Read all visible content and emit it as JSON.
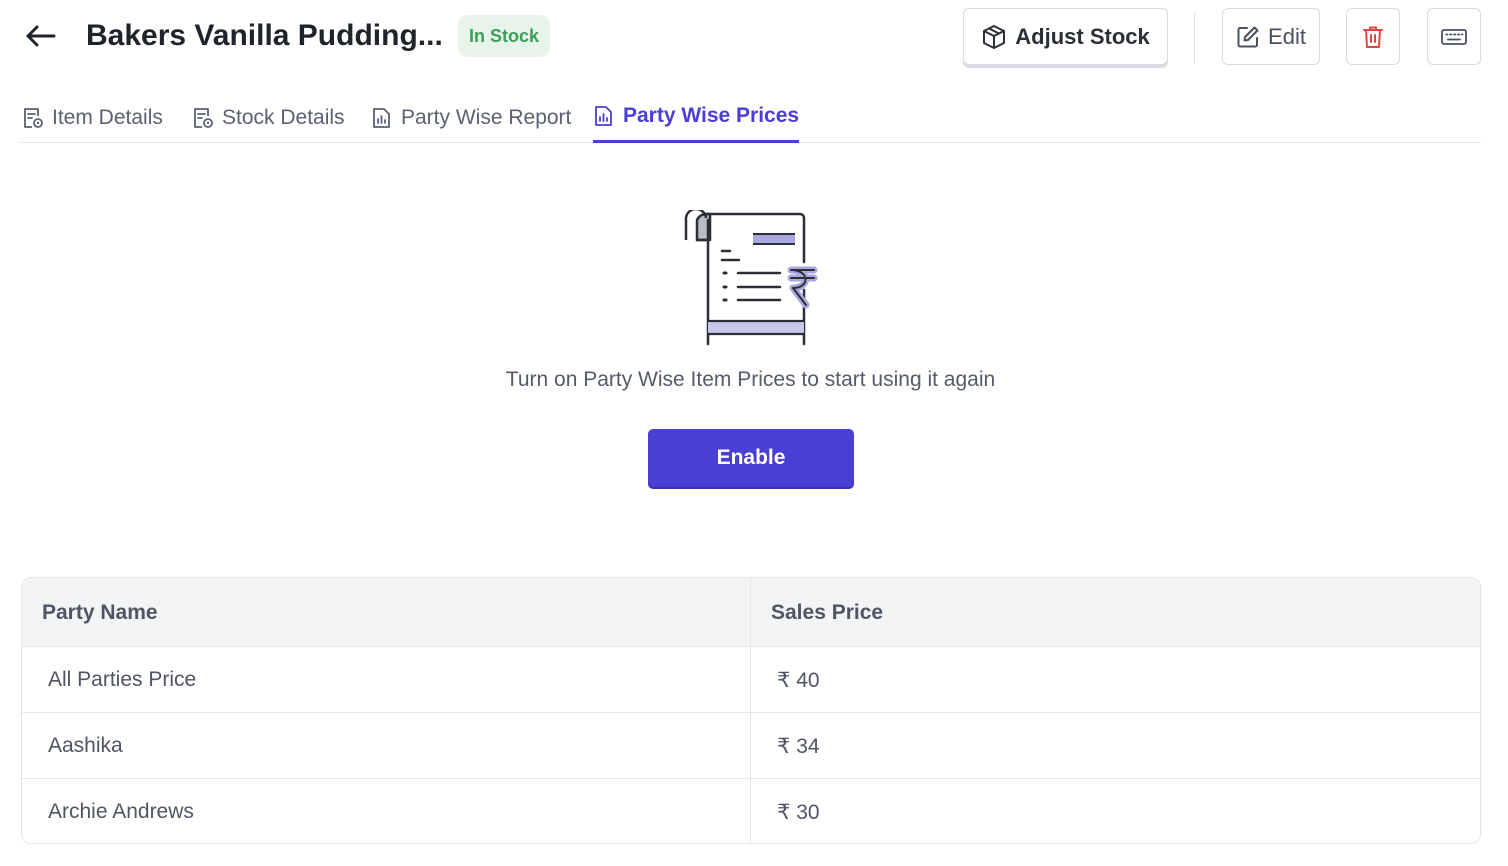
{
  "header": {
    "title": "Bakers Vanilla Pudding...",
    "status_badge": "In Stock",
    "adjust_stock_label": "Adjust Stock",
    "edit_label": "Edit",
    "icons": {
      "back": "arrow-left-icon",
      "adjust": "box-icon",
      "edit": "edit-icon",
      "delete": "trash-icon",
      "keyboard": "keyboard-icon"
    }
  },
  "tabs": [
    {
      "label": "Item Details",
      "icon": "document-gear-icon",
      "active": false
    },
    {
      "label": "Stock Details",
      "icon": "document-gear-icon",
      "active": false
    },
    {
      "label": "Party Wise Report",
      "icon": "report-chart-icon",
      "active": false
    },
    {
      "label": "Party Wise Prices",
      "icon": "report-chart-icon",
      "active": true
    }
  ],
  "empty_state": {
    "message": "Turn on Party Wise Item Prices to start using it again",
    "button_label": "Enable",
    "illustration": "rupee-receipt-icon"
  },
  "table": {
    "headers": [
      "Party Name",
      "Sales Price"
    ],
    "rows": [
      {
        "party": "All Parties Price",
        "price": "₹ 40"
      },
      {
        "party": "Aashika",
        "price": "₹ 34"
      },
      {
        "party": "Archie Andrews",
        "price": "₹ 30"
      }
    ]
  },
  "colors": {
    "accent": "#4a3fd4",
    "badge_bg": "#e6f4ea",
    "badge_text": "#3e9d5a",
    "delete": "#e0473f"
  }
}
